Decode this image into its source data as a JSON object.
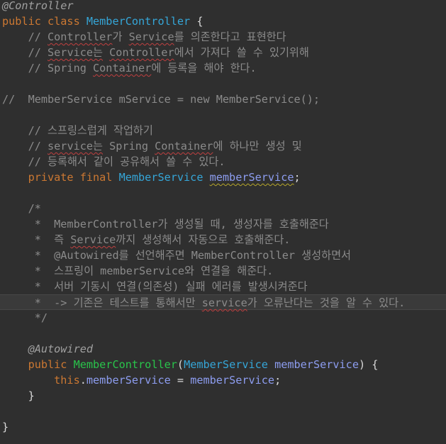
{
  "editor": {
    "lines": [
      [
        {
          "t": "@Controller",
          "c": "ann"
        }
      ],
      [
        {
          "t": "public class ",
          "c": "kw"
        },
        {
          "t": "MemberController",
          "c": "cls"
        },
        {
          "t": " {",
          "c": "plain"
        }
      ],
      [
        {
          "t": "    // ",
          "c": "cm"
        },
        {
          "t": "Controller",
          "c": "cm sq"
        },
        {
          "t": "가 ",
          "c": "cm"
        },
        {
          "t": "Service",
          "c": "cm sq"
        },
        {
          "t": "를 의존한다고 표현한다",
          "c": "cm"
        }
      ],
      [
        {
          "t": "    // ",
          "c": "cm"
        },
        {
          "t": "Service는",
          "c": "cm sq"
        },
        {
          "t": " ",
          "c": "cm"
        },
        {
          "t": "Controller",
          "c": "cm sq"
        },
        {
          "t": "에서 가져다 쓸 수 있기위해",
          "c": "cm"
        }
      ],
      [
        {
          "t": "    // Spring ",
          "c": "cm"
        },
        {
          "t": "Container",
          "c": "cm sq"
        },
        {
          "t": "에 등록을 해야 한다.",
          "c": "cm"
        }
      ],
      [],
      [
        {
          "t": "//  MemberService mService = new MemberService();",
          "c": "cm"
        }
      ],
      [],
      [
        {
          "t": "    // 스프링스럽게 작업하기",
          "c": "cm"
        }
      ],
      [
        {
          "t": "    // ",
          "c": "cm"
        },
        {
          "t": "service는",
          "c": "cm sq"
        },
        {
          "t": " Spring ",
          "c": "cm"
        },
        {
          "t": "Container",
          "c": "cm sq"
        },
        {
          "t": "에 하나만 생성 및",
          "c": "cm"
        }
      ],
      [
        {
          "t": "    // 등록해서 같이 공유해서 쓸 수 있다.",
          "c": "cm"
        }
      ],
      [
        {
          "t": "    private final ",
          "c": "kw"
        },
        {
          "t": "MemberService",
          "c": "cls"
        },
        {
          "t": " ",
          "c": "plain"
        },
        {
          "t": "memberService",
          "c": "fld sqy"
        },
        {
          "t": ";",
          "c": "plain"
        }
      ],
      [],
      [
        {
          "t": "    /*",
          "c": "cm"
        }
      ],
      [
        {
          "t": "     *  MemberController가 생성될 때, 생성자를 호출해준다",
          "c": "cm"
        }
      ],
      [
        {
          "t": "     *  즉 ",
          "c": "cm"
        },
        {
          "t": "Service",
          "c": "cm sq"
        },
        {
          "t": "까지 생성해서 자동으로 호출해준다.",
          "c": "cm"
        }
      ],
      [
        {
          "t": "     *  @Autowired를 선언해주면 MemberController 생성하면서",
          "c": "cm"
        }
      ],
      [
        {
          "t": "     *  스프링이 memberService와 연결을 해준다.",
          "c": "cm"
        }
      ],
      [
        {
          "t": "     *  서버 기동시 연결(의존성) 실패 에러를 발생시켜준다",
          "c": "cm"
        }
      ],
      [
        {
          "t": "     *  -> 기존은 테스트를 통해서만 ",
          "c": "cm"
        },
        {
          "t": "service",
          "c": "cm sq"
        },
        {
          "t": "가 오류난다는 것을 알 수 있다.",
          "c": "cm"
        }
      ],
      [
        {
          "t": "     */",
          "c": "cm"
        }
      ],
      [],
      [
        {
          "t": "    @Autowired",
          "c": "ann"
        }
      ],
      [
        {
          "t": "    public ",
          "c": "kw"
        },
        {
          "t": "MemberController",
          "c": "mth"
        },
        {
          "t": "(",
          "c": "plain"
        },
        {
          "t": "MemberService",
          "c": "cls"
        },
        {
          "t": " ",
          "c": "plain"
        },
        {
          "t": "memberService",
          "c": "param"
        },
        {
          "t": ") {",
          "c": "plain"
        }
      ],
      [
        {
          "t": "        this",
          "c": "kw"
        },
        {
          "t": ".",
          "c": "plain"
        },
        {
          "t": "memberService",
          "c": "fld"
        },
        {
          "t": " = ",
          "c": "plain"
        },
        {
          "t": "memberService",
          "c": "param"
        },
        {
          "t": ";",
          "c": "plain"
        }
      ],
      [
        {
          "t": "    }",
          "c": "plain"
        }
      ],
      [],
      [
        {
          "t": "}",
          "c": "plain"
        }
      ]
    ],
    "current_line": 19
  }
}
